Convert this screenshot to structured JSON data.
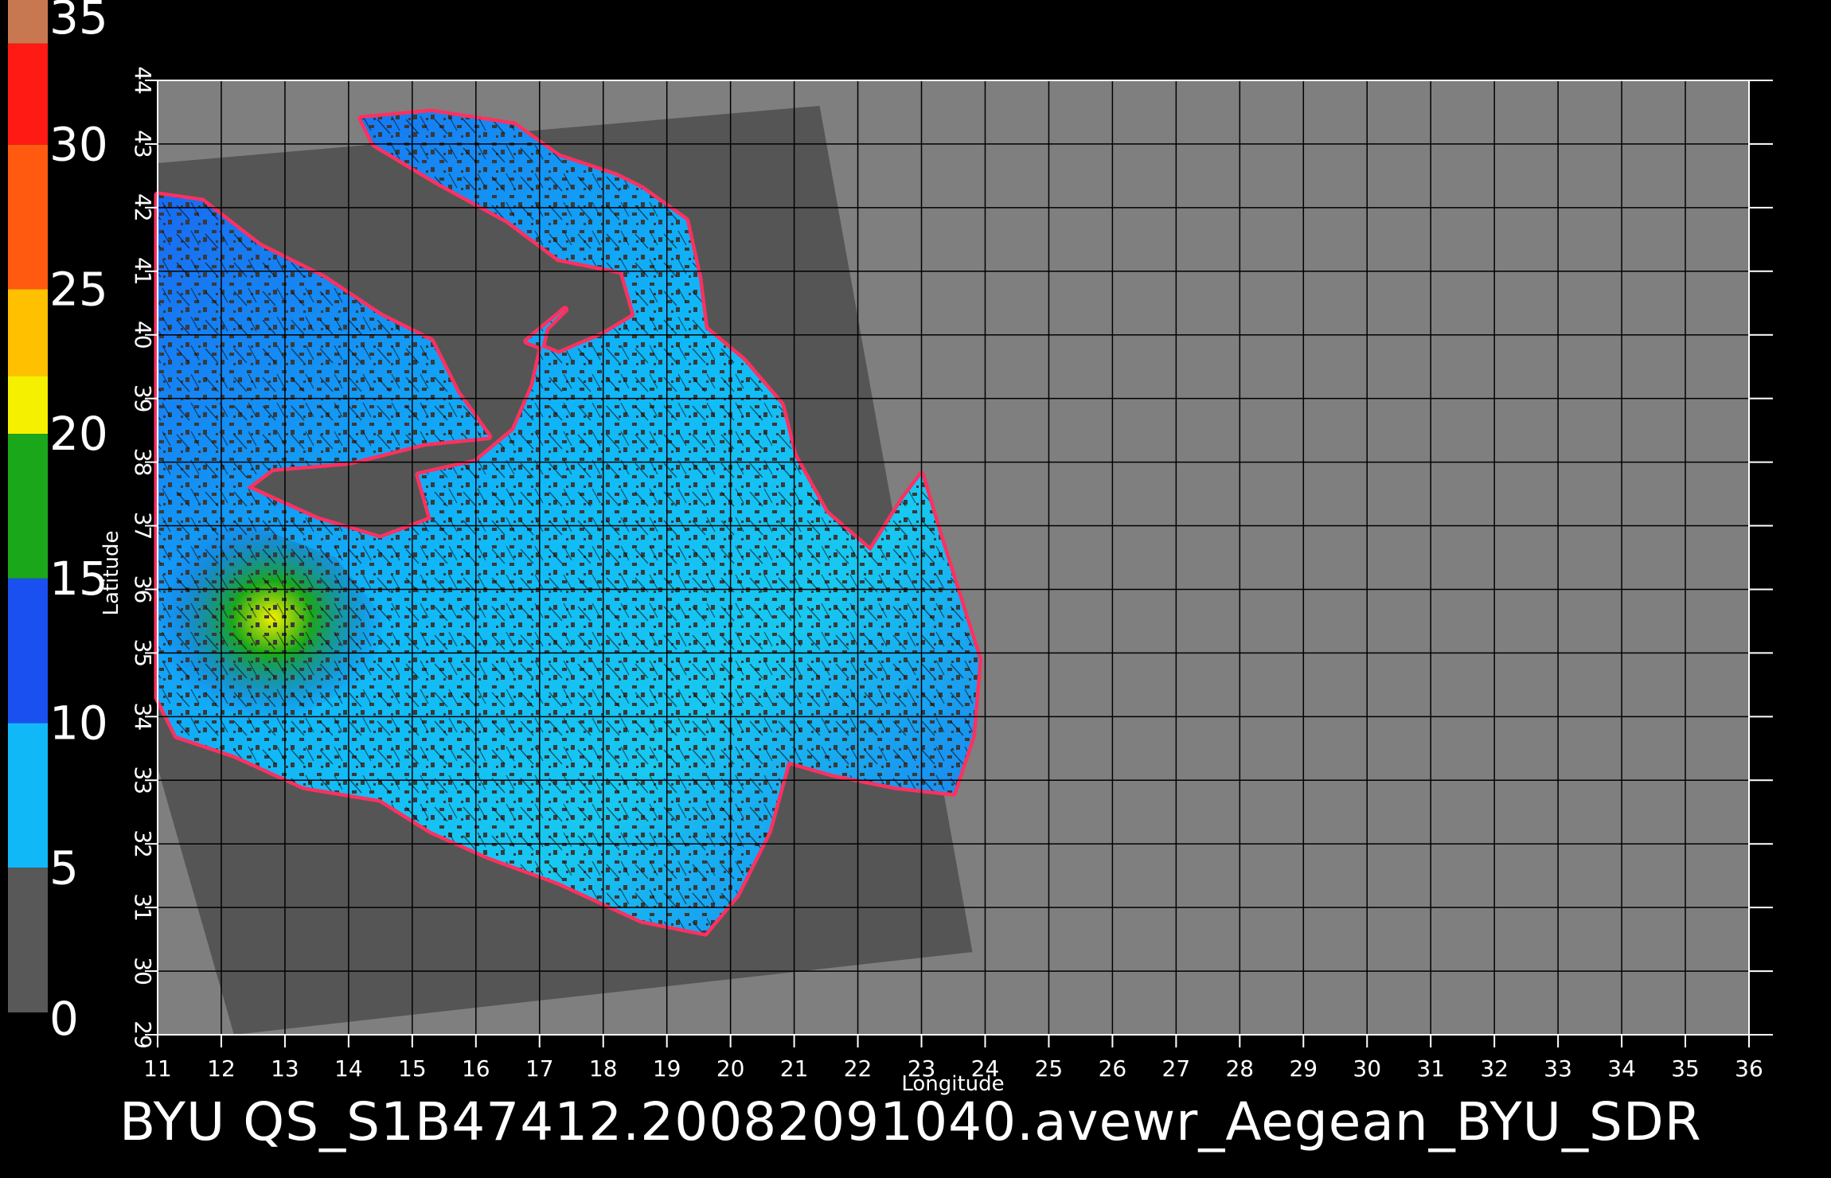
{
  "title": "BYU  QS_S1B47412.20082091040.avewr_Aegean_BYU_SDR",
  "colorbar": {
    "labels": [
      "35",
      "30",
      "25",
      "20",
      "15",
      "10",
      "5",
      "0"
    ],
    "segments": [
      {
        "from": 35,
        "to": 33.5,
        "color": "#c87850"
      },
      {
        "from": 33.5,
        "to": 30,
        "color": "#ff1a14"
      },
      {
        "from": 30,
        "to": 25,
        "color": "#ff5a10"
      },
      {
        "from": 25,
        "to": 22,
        "color": "#ffc000"
      },
      {
        "from": 22,
        "to": 20,
        "color": "#f4f000"
      },
      {
        "from": 20,
        "to": 15,
        "color": "#1aa81a"
      },
      {
        "from": 15,
        "to": 10,
        "color": "#1a50f0"
      },
      {
        "from": 10,
        "to": 5,
        "color": "#10b8f8"
      },
      {
        "from": 5,
        "to": 0,
        "color": "#585858"
      }
    ]
  },
  "axes": {
    "xlabel": "Longitude",
    "ylabel": "Latitude",
    "xlim": [
      11,
      36
    ],
    "ylim": [
      29,
      44
    ],
    "xticks": [
      "11",
      "12",
      "13",
      "14",
      "15",
      "16",
      "17",
      "18",
      "19",
      "20",
      "21",
      "22",
      "23",
      "24",
      "25",
      "26",
      "27",
      "28",
      "29",
      "30",
      "31",
      "32",
      "33",
      "34",
      "35",
      "36"
    ],
    "yticks": [
      "29",
      "30",
      "31",
      "32",
      "33",
      "34",
      "35",
      "36",
      "37",
      "38",
      "39",
      "40",
      "41",
      "42",
      "43",
      "44"
    ],
    "grid": true
  },
  "swath": {
    "corners": [
      [
        11.0,
        42.7
      ],
      [
        21.4,
        43.6
      ],
      [
        23.8,
        30.3
      ],
      [
        12.2,
        29.0
      ],
      [
        11.0,
        33.2
      ]
    ]
  },
  "colors": {
    "no_data": "#7f7f7f",
    "swath_land": "#555555",
    "background": "#000000"
  }
}
